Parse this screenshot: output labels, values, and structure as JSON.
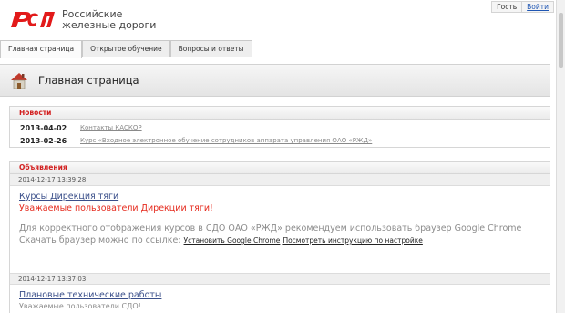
{
  "header": {
    "brand_line1": "Российские",
    "brand_line2": "железные дороги",
    "user_guest": "Гость",
    "login_label": "Войти"
  },
  "tabs": [
    {
      "label": "Главная страница",
      "active": true
    },
    {
      "label": "Открытое обучение",
      "active": false
    },
    {
      "label": "Вопросы и ответы",
      "active": false
    }
  ],
  "page": {
    "title": "Главная страница"
  },
  "news": {
    "heading": "Новости",
    "items": [
      {
        "date": "2013-04-02",
        "text": "Контакты КАСКОР"
      },
      {
        "date": "2013-02-26",
        "text": "Курс «Входное электронное обучение сотрудников аппарата управления ОАО «РЖД»"
      }
    ]
  },
  "announcements": {
    "heading": "Объявления",
    "items": [
      {
        "time": "2014-12-17 13:39:28",
        "title": "Курсы Дирекция тяги",
        "highlight": "Уважаемые пользователи Дирекции тяги!",
        "text": "Для корректного отображения курсов в СДО ОАО «РЖД» рекомендуем использовать браузер Google Chrome",
        "download_prefix": "Скачать браузер можно по ссылке:",
        "link1": "Установить Google Chrome",
        "link2": "Посмотреть инструкцию по настройке"
      },
      {
        "time": "2014-12-17 13:37:03",
        "title": "Плановые технические работы",
        "text": "Уважаемые пользователи СДО!"
      }
    ]
  },
  "colors": {
    "brand_red": "#e21a1a",
    "heading_red": "#d21f1f",
    "link_blue": "#3a4f8a"
  }
}
